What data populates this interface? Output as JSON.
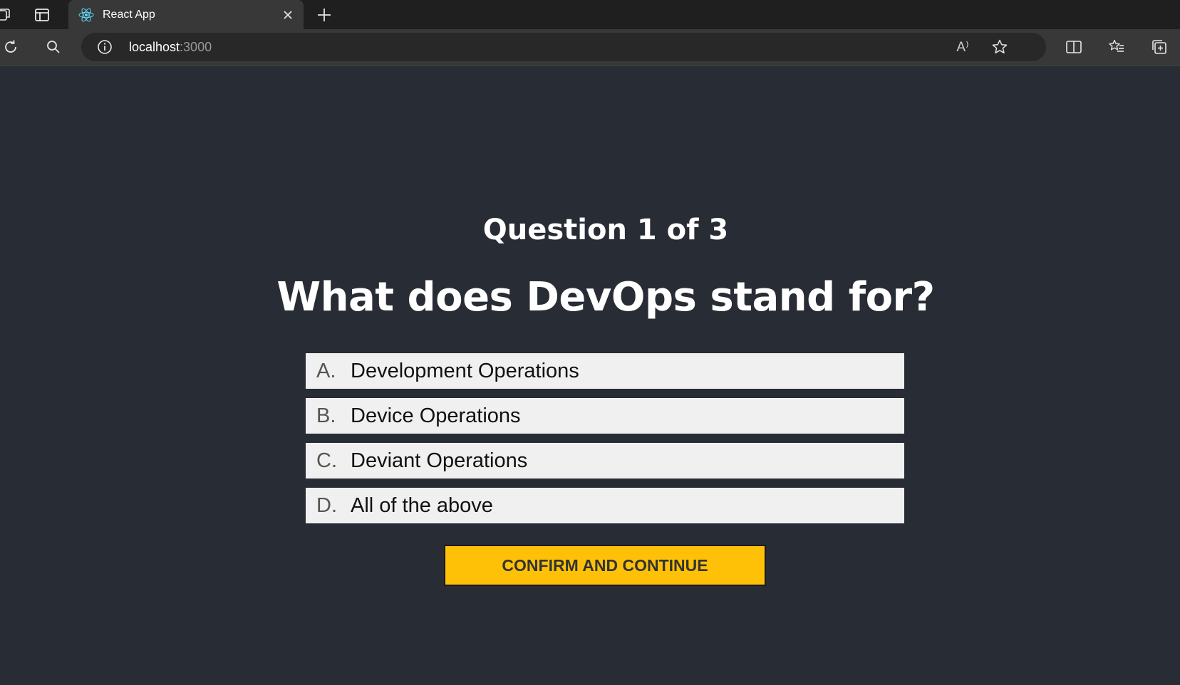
{
  "browser": {
    "tab": {
      "title": "React App",
      "favicon": "react-logo-icon"
    },
    "address": {
      "host": "localhost",
      "port": ":3000"
    },
    "read_aloud_glyph": "A⁾"
  },
  "quiz": {
    "counter": "Question 1 of 3",
    "question": "What does DevOps stand for?",
    "options": [
      {
        "letter": "A.",
        "label": "Development Operations"
      },
      {
        "letter": "B.",
        "label": "Device Operations"
      },
      {
        "letter": "C.",
        "label": "Deviant Operations"
      },
      {
        "letter": "D.",
        "label": "All of the above"
      }
    ],
    "confirm_label": "CONFIRM AND CONTINUE"
  },
  "colors": {
    "page_background": "#282c34",
    "option_background": "#f0f0f0",
    "confirm_background": "#ffc107"
  }
}
